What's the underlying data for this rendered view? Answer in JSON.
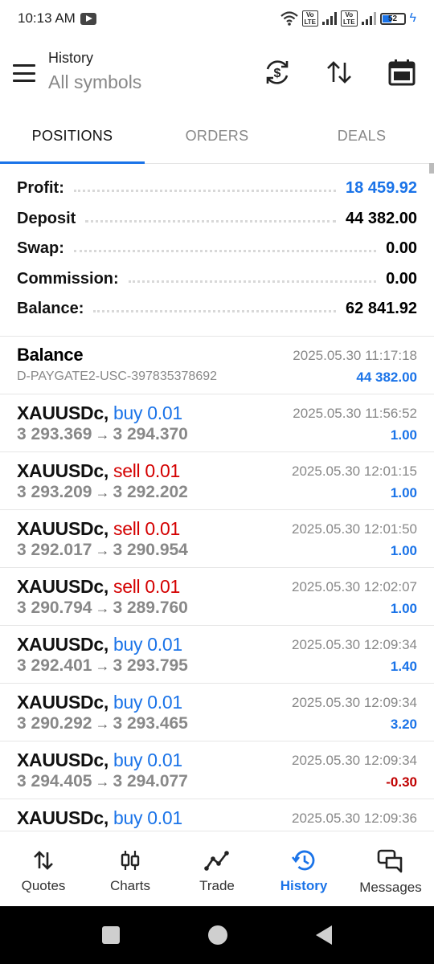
{
  "status_bar": {
    "time": "10:13 AM",
    "battery": "52"
  },
  "header": {
    "title": "History",
    "subtitle": "All symbols"
  },
  "tabs": [
    {
      "label": "POSITIONS",
      "active": true
    },
    {
      "label": "ORDERS",
      "active": false
    },
    {
      "label": "DEALS",
      "active": false
    }
  ],
  "summary": [
    {
      "label": "Profit:",
      "value": "18 459.92",
      "color": "#1a73e8"
    },
    {
      "label": "Deposit",
      "value": "44 382.00",
      "color": "#111111"
    },
    {
      "label": "Swap:",
      "value": "0.00",
      "color": "#111111"
    },
    {
      "label": "Commission:",
      "value": "0.00",
      "color": "#111111"
    },
    {
      "label": "Balance:",
      "value": "62 841.92",
      "color": "#111111"
    }
  ],
  "balance_entry": {
    "title": "Balance",
    "comment": "D-PAYGATE2-USC-397835378692",
    "date": "2025.05.30 11:17:18",
    "amount": "44 382.00"
  },
  "positions": [
    {
      "symbol": "XAUUSDc,",
      "direction": "buy 0.01",
      "type": "buy",
      "open": "3 293.369",
      "close": "3 294.370",
      "date": "2025.05.30 11:56:52",
      "profit": "1.00",
      "profit_color": "#1a73e8"
    },
    {
      "symbol": "XAUUSDc,",
      "direction": "sell 0.01",
      "type": "sell",
      "open": "3 293.209",
      "close": "3 292.202",
      "date": "2025.05.30 12:01:15",
      "profit": "1.00",
      "profit_color": "#1a73e8"
    },
    {
      "symbol": "XAUUSDc,",
      "direction": "sell 0.01",
      "type": "sell",
      "open": "3 292.017",
      "close": "3 290.954",
      "date": "2025.05.30 12:01:50",
      "profit": "1.00",
      "profit_color": "#1a73e8"
    },
    {
      "symbol": "XAUUSDc,",
      "direction": "sell 0.01",
      "type": "sell",
      "open": "3 290.794",
      "close": "3 289.760",
      "date": "2025.05.30 12:02:07",
      "profit": "1.00",
      "profit_color": "#1a73e8"
    },
    {
      "symbol": "XAUUSDc,",
      "direction": "buy 0.01",
      "type": "buy",
      "open": "3 292.401",
      "close": "3 293.795",
      "date": "2025.05.30 12:09:34",
      "profit": "1.40",
      "profit_color": "#1a73e8"
    },
    {
      "symbol": "XAUUSDc,",
      "direction": "buy 0.01",
      "type": "buy",
      "open": "3 290.292",
      "close": "3 293.465",
      "date": "2025.05.30 12:09:34",
      "profit": "3.20",
      "profit_color": "#1a73e8"
    },
    {
      "symbol": "XAUUSDc,",
      "direction": "buy 0.01",
      "type": "buy",
      "open": "3 294.405",
      "close": "3 294.077",
      "date": "2025.05.30 12:09:34",
      "profit": "-0.30",
      "profit_color": "#c00000"
    },
    {
      "symbol": "XAUUSDc,",
      "direction": "buy 0.01",
      "type": "buy",
      "open": "",
      "close": "",
      "date": "2025.05.30 12:09:36",
      "profit": "",
      "profit_color": "#1a73e8"
    }
  ],
  "bottom_nav": [
    {
      "label": "Quotes",
      "icon": "quotes-icon",
      "active": false
    },
    {
      "label": "Charts",
      "icon": "charts-icon",
      "active": false
    },
    {
      "label": "Trade",
      "icon": "trade-icon",
      "active": false
    },
    {
      "label": "History",
      "icon": "history-icon",
      "active": true
    },
    {
      "label": "Messages",
      "icon": "messages-icon",
      "active": false
    }
  ],
  "colors": {
    "accent": "#1a73e8",
    "sell": "#d40000",
    "loss": "#c00000"
  }
}
